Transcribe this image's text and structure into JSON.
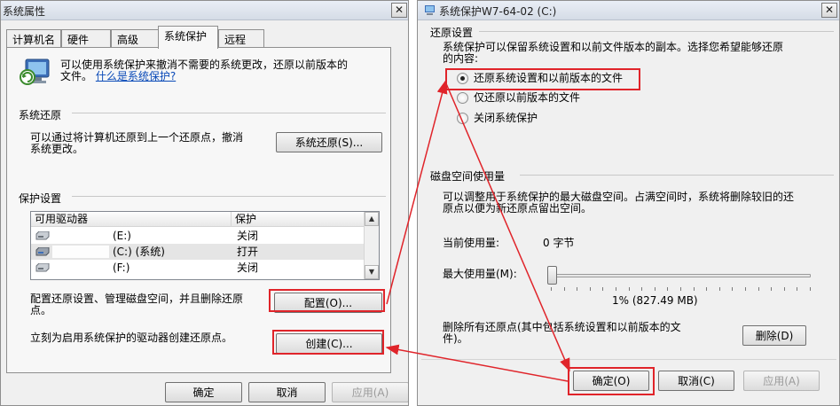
{
  "left_window": {
    "title": "系统属性",
    "tabs": [
      "计算机名",
      "硬件",
      "高级",
      "系统保护",
      "远程"
    ],
    "active_tab": "系统保护",
    "intro_text_1": "可以使用系统保护来撤消不需要的系统更改，还原以前版本的",
    "intro_text_2": "文件。",
    "intro_link": "什么是系统保护?",
    "restore_group": "系统还原",
    "restore_desc_1": "可以通过将计算机还原到上一个还原点，撤消",
    "restore_desc_2": "系统更改。",
    "restore_button": "系统还原(S)...",
    "protection_group": "保护设置",
    "columns": [
      "可用驱动器",
      "保护"
    ],
    "drives": [
      {
        "name": "(E:)",
        "status": "关闭"
      },
      {
        "name": "(C:) (系统)",
        "status": "打开"
      },
      {
        "name": "(F:)",
        "status": "关闭"
      }
    ],
    "config_desc_1": "配置还原设置、管理磁盘空间，并且删除还原",
    "config_desc_2": "点。",
    "config_button": "配置(O)...",
    "create_desc": "立刻为启用系统保护的驱动器创建还原点。",
    "create_button": "创建(C)...",
    "ok": "确定",
    "cancel": "取消",
    "apply": "应用(A)"
  },
  "right_window": {
    "title": "系统保护W7-64-02 (C:)",
    "restore_group": "还原设置",
    "restore_desc_1": "系统保护可以保留系统设置和以前文件版本的副本。选择您希望能够还原",
    "restore_desc_2": "的内容:",
    "options": [
      "还原系统设置和以前版本的文件",
      "仅还原以前版本的文件",
      "关闭系统保护"
    ],
    "selected_option": 0,
    "disk_group": "磁盘空间使用量",
    "disk_desc_1": "可以调整用于系统保护的最大磁盘空间。占满空间时，系统将删除较旧的还",
    "disk_desc_2": "原点以便为新还原点留出空间。",
    "current_label": "当前使用量:",
    "current_value": "0 字节",
    "max_label": "最大使用量(M):",
    "slider_value_fraction": 0.01,
    "slider_readout": "1% (827.49 MB)",
    "delete_desc_1": "删除所有还原点(其中包括系统设置和以前版本的文",
    "delete_desc_2": "件)。",
    "delete_button": "删除(D)",
    "ok": "确定(O)",
    "cancel": "取消(C)",
    "apply": "应用(A)"
  },
  "annotation_color": "#e0242a"
}
